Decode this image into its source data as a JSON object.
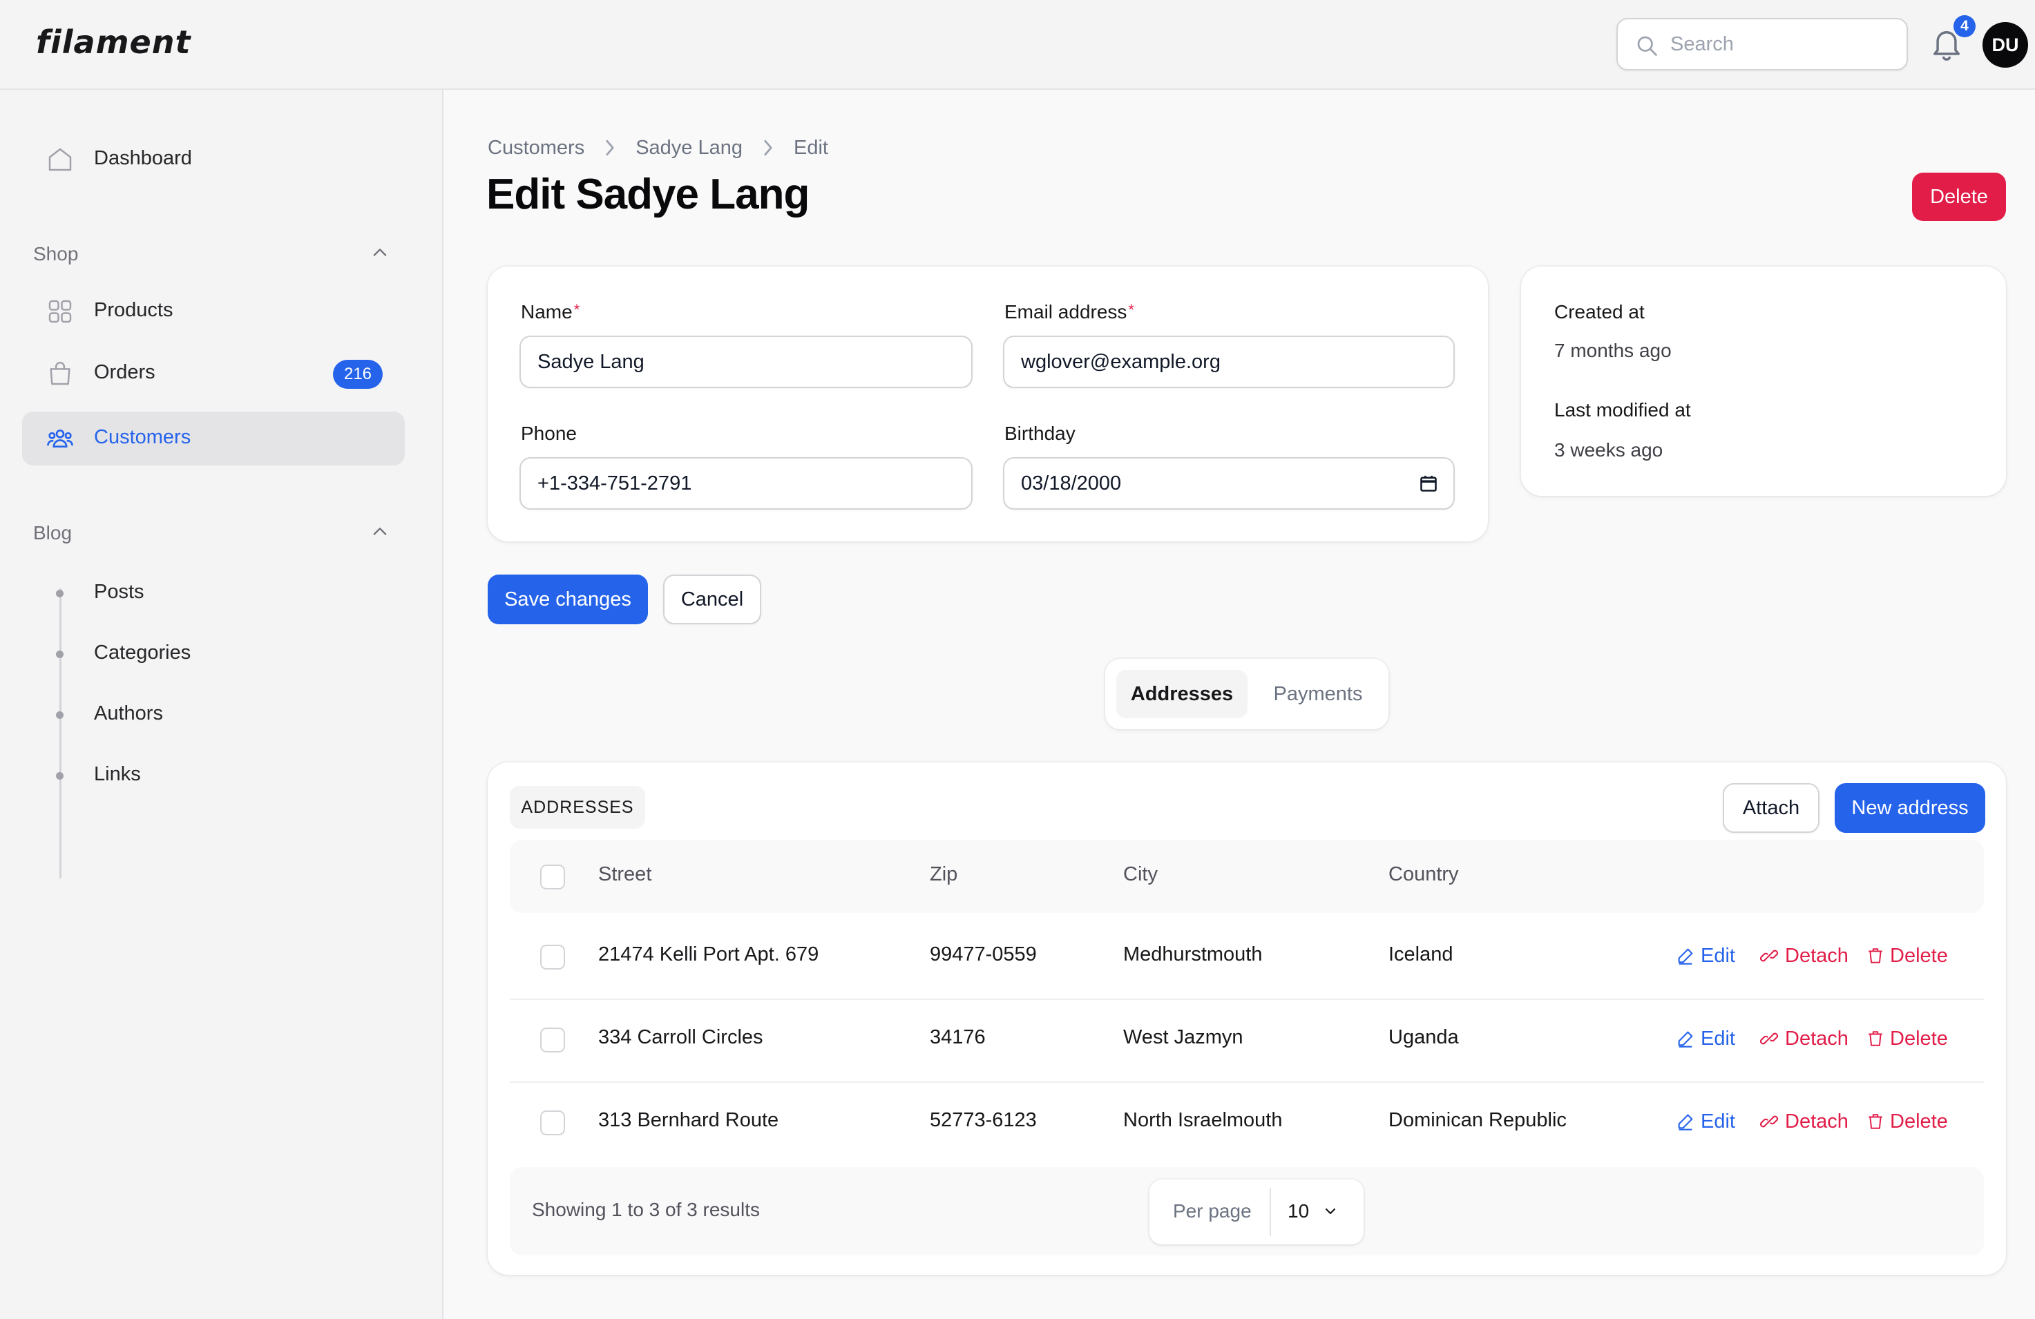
{
  "app": {
    "logo": "filament"
  },
  "topbar": {
    "search_placeholder": "Search",
    "notifications_count": "4",
    "avatar_initials": "DU"
  },
  "sidebar": {
    "dashboard": "Dashboard",
    "shop_group": "Shop",
    "shop_items": [
      {
        "label": "Products",
        "icon": "products-icon"
      },
      {
        "label": "Orders",
        "icon": "shopping-bag-icon",
        "badge": "216"
      },
      {
        "label": "Customers",
        "icon": "users-icon",
        "active": true
      }
    ],
    "blog_group": "Blog",
    "blog_items": [
      "Posts",
      "Categories",
      "Authors",
      "Links"
    ]
  },
  "breadcrumb": [
    "Customers",
    "Sadye Lang",
    "Edit"
  ],
  "page": {
    "title": "Edit Sadye Lang",
    "delete_label": "Delete"
  },
  "form": {
    "name_label": "Name",
    "name_value": "Sadye Lang",
    "email_label": "Email address",
    "email_value": "wglover@example.org",
    "phone_label": "Phone",
    "phone_value": "+1-334-751-2791",
    "birthday_label": "Birthday",
    "birthday_value": "03/18/2000",
    "required_mark": "*"
  },
  "meta": {
    "created_label": "Created at",
    "created_value": "7 months ago",
    "modified_label": "Last modified at",
    "modified_value": "3 weeks ago"
  },
  "actions": {
    "save": "Save changes",
    "cancel": "Cancel"
  },
  "tabs": [
    {
      "label": "Addresses",
      "active": true
    },
    {
      "label": "Payments",
      "active": false
    }
  ],
  "addresses": {
    "section_label": "ADDRESSES",
    "attach_label": "Attach",
    "new_label": "New address",
    "columns": [
      "Street",
      "Zip",
      "City",
      "Country"
    ],
    "rows": [
      {
        "street": "21474 Kelli Port Apt. 679",
        "zip": "99477-0559",
        "city": "Medhurstmouth",
        "country": "Iceland"
      },
      {
        "street": "334 Carroll Circles",
        "zip": "34176",
        "city": "West Jazmyn",
        "country": "Uganda"
      },
      {
        "street": "313 Bernhard Route",
        "zip": "52773-6123",
        "city": "North Israelmouth",
        "country": "Dominican Republic"
      }
    ],
    "row_actions": {
      "edit": "Edit",
      "detach": "Detach",
      "delete": "Delete"
    },
    "footer": {
      "results_text": "Showing 1 to 3 of 3 results",
      "per_page_label": "Per page",
      "per_page_value": "10"
    }
  },
  "colors": {
    "primary": "#2563eb",
    "danger": "#e11d48",
    "sidebar_bg": "#f4f4f5"
  }
}
